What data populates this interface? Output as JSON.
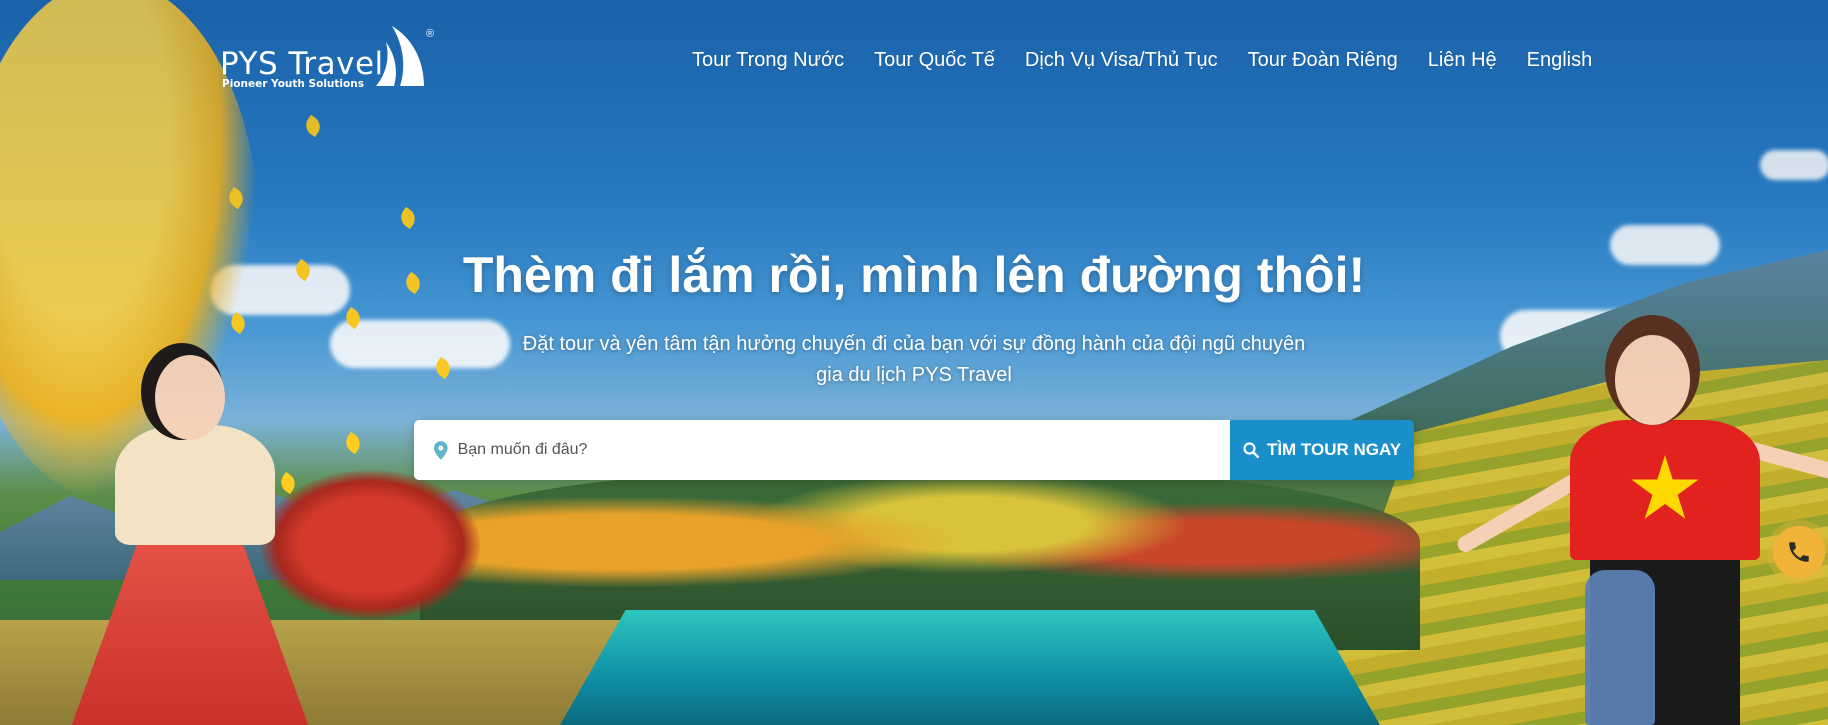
{
  "brand": {
    "name": "PYS Travel",
    "tagline": "Pioneer Youth Solutions",
    "registered_mark": "®"
  },
  "nav": {
    "items": [
      {
        "label": "Tour Trong Nước"
      },
      {
        "label": "Tour Quốc Tế"
      },
      {
        "label": "Dịch Vụ Visa/Thủ Tục"
      },
      {
        "label": "Tour Đoàn Riêng"
      },
      {
        "label": "Liên Hệ"
      },
      {
        "label": "English"
      }
    ]
  },
  "hero": {
    "headline": "Thèm đi lắm rồi, mình lên đường thôi!",
    "subline": "Đặt tour và yên tâm tận hưởng chuyến đi của bạn với sự đồng hành của đội ngũ chuyên gia du lịch PYS Travel"
  },
  "search": {
    "placeholder": "Bạn muốn đi đâu?",
    "value": "",
    "button_label": "TÌM TOUR NGAY",
    "icon": "location-pin-icon",
    "button_icon": "search-icon"
  },
  "floating": {
    "phone_icon": "phone-icon"
  },
  "colors": {
    "accent": "#1a8fc9",
    "phone_button": "#f1b438",
    "text_light": "#ffffff"
  }
}
